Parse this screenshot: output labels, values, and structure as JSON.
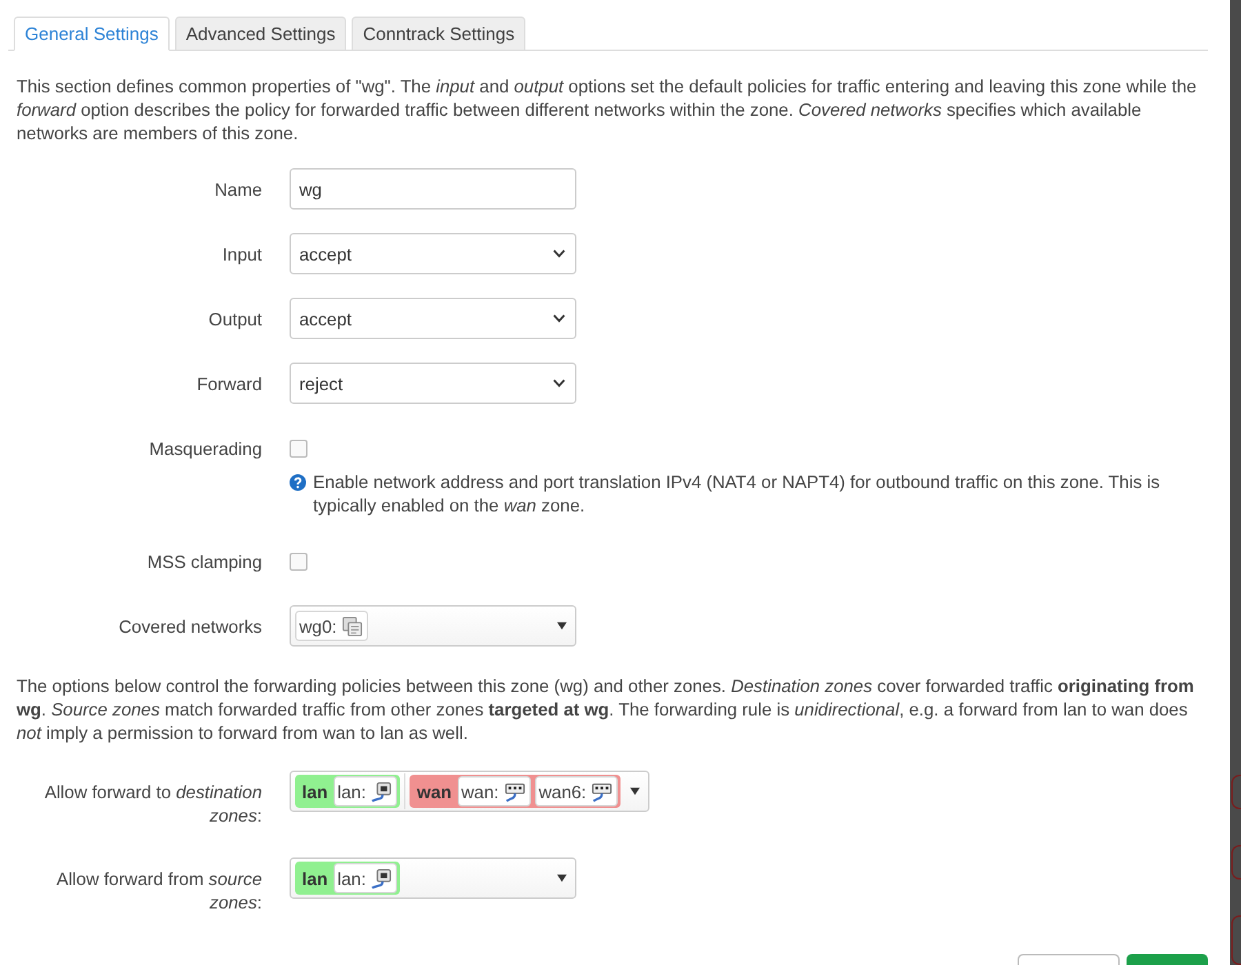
{
  "tabs": [
    {
      "label": "General Settings",
      "selected": true
    },
    {
      "label": "Advanced Settings",
      "selected": false
    },
    {
      "label": "Conntrack Settings",
      "selected": false
    }
  ],
  "description": "This section defines common properties of \"wg\". The *input* and *output* options set the default policies for traffic entering and leaving this zone while the *forward* option describes the policy for forwarded traffic between different networks within the zone. *Covered networks* specifies which available networks are members of this zone.",
  "fields": [
    {
      "kind": "text",
      "label": "Name",
      "value": "wg"
    },
    {
      "kind": "select",
      "label": "Input",
      "value": "accept"
    },
    {
      "kind": "select",
      "label": "Output",
      "value": "accept"
    },
    {
      "kind": "select",
      "label": "Forward",
      "value": "reject"
    },
    {
      "kind": "checkbox",
      "label": "Masquerading",
      "checked": false,
      "help": "Enable network address and port translation IPv4 (NAT4 or NAPT4) for outbound traffic on this zone. This is typically enabled on the *wan* zone."
    },
    {
      "kind": "checkbox",
      "label": "MSS clamping",
      "checked": false
    },
    {
      "kind": "networks",
      "label": "Covered networks",
      "networks": [
        {
          "name": "wg0:",
          "kind": "tunnel"
        }
      ]
    }
  ],
  "forwarding_description": "The options below control the forwarding policies between this zone (wg) and other zones. *Destination zones* cover forwarded traffic **originating from wg**. *Source zones* match forwarded traffic from other zones **targeted at wg**. The forwarding rule is *unidirectional*, e.g. a forward from lan to wan does *not* imply a permission to forward from wan to lan as well.",
  "forwarding": [
    {
      "label": "Allow forward to *destination zones*:",
      "zones": [
        {
          "name": "lan",
          "color": "#90f090",
          "networks": [
            {
              "name": "lan:",
              "kind": "bridge"
            }
          ]
        },
        {
          "name": "wan",
          "color": "#f09090",
          "networks": [
            {
              "name": "wan:",
              "kind": "ethernet"
            },
            {
              "name": "wan6:",
              "kind": "ethernet"
            }
          ]
        }
      ]
    },
    {
      "label": "Allow forward from *source zones*:",
      "zones": [
        {
          "name": "lan",
          "color": "#90f090",
          "networks": [
            {
              "name": "lan:",
              "kind": "bridge"
            }
          ]
        }
      ]
    }
  ],
  "footer_buttons": [
    {
      "kind": "secondary"
    },
    {
      "kind": "primary"
    }
  ]
}
